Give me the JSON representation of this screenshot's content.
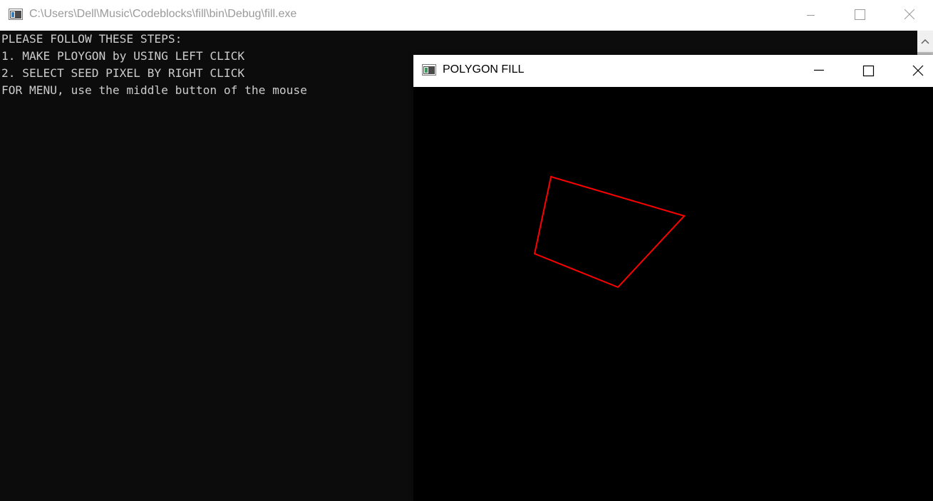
{
  "console": {
    "title": "C:\\Users\\Dell\\Music\\Codeblocks\\fill\\bin\\Debug\\fill.exe",
    "lines": [
      "PLEASE FOLLOW THESE STEPS:",
      "1. MAKE PLOYGON by USING LEFT CLICK",
      "2. SELECT SEED PIXEL BY RIGHT CLICK",
      "FOR MENU, use the middle button of the mouse"
    ],
    "text_color": "#cccccc",
    "background": "#0c0c0c"
  },
  "graphics_window": {
    "title": "POLYGON FILL",
    "background": "#000000",
    "polygon_color": "#ff0000"
  },
  "icons": {
    "app_icon": "console-app-icon",
    "minimize": "minimize-icon",
    "maximize": "maximize-icon",
    "close": "close-icon",
    "scroll_up": "chevron-up-icon"
  }
}
